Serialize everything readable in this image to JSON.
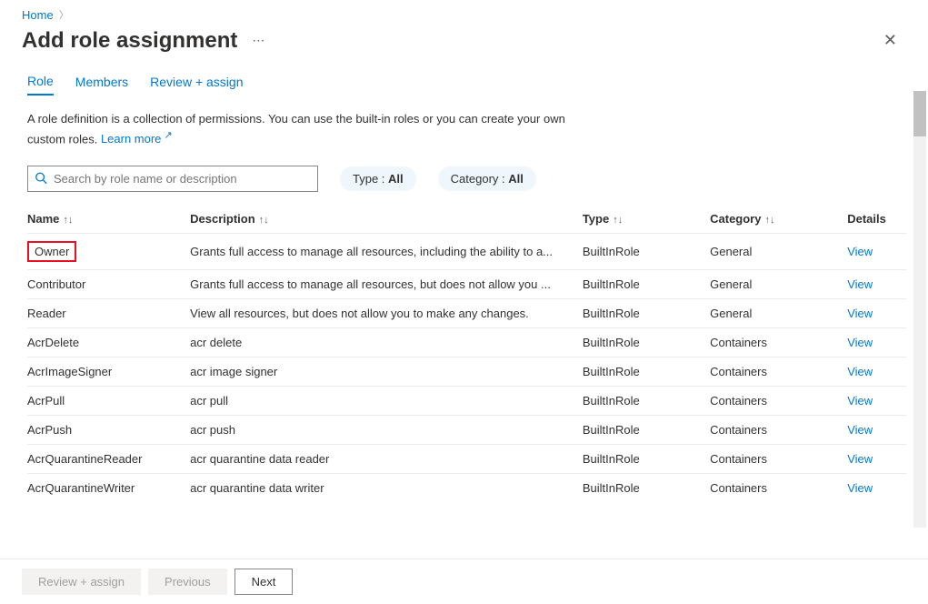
{
  "breadcrumb": {
    "home": "Home"
  },
  "page": {
    "title": "Add role assignment"
  },
  "tabs": {
    "role": "Role",
    "members": "Members",
    "review": "Review + assign"
  },
  "description": {
    "text": "A role definition is a collection of permissions. You can use the built-in roles or you can create your own custom roles.",
    "learn_more": "Learn more"
  },
  "search": {
    "placeholder": "Search by role name or description"
  },
  "filters": {
    "type_label": "Type : ",
    "type_value": "All",
    "category_label": "Category : ",
    "category_value": "All"
  },
  "columns": {
    "name": "Name",
    "description": "Description",
    "type": "Type",
    "category": "Category",
    "details": "Details"
  },
  "view_label": "View",
  "roles": [
    {
      "name": "Owner",
      "description": "Grants full access to manage all resources, including the ability to a...",
      "type": "BuiltInRole",
      "category": "General",
      "highlighted": true
    },
    {
      "name": "Contributor",
      "description": "Grants full access to manage all resources, but does not allow you ...",
      "type": "BuiltInRole",
      "category": "General"
    },
    {
      "name": "Reader",
      "description": "View all resources, but does not allow you to make any changes.",
      "type": "BuiltInRole",
      "category": "General"
    },
    {
      "name": "AcrDelete",
      "description": "acr delete",
      "type": "BuiltInRole",
      "category": "Containers"
    },
    {
      "name": "AcrImageSigner",
      "description": "acr image signer",
      "type": "BuiltInRole",
      "category": "Containers"
    },
    {
      "name": "AcrPull",
      "description": "acr pull",
      "type": "BuiltInRole",
      "category": "Containers"
    },
    {
      "name": "AcrPush",
      "description": "acr push",
      "type": "BuiltInRole",
      "category": "Containers"
    },
    {
      "name": "AcrQuarantineReader",
      "description": "acr quarantine data reader",
      "type": "BuiltInRole",
      "category": "Containers"
    },
    {
      "name": "AcrQuarantineWriter",
      "description": "acr quarantine data writer",
      "type": "BuiltInRole",
      "category": "Containers"
    }
  ],
  "footer": {
    "review": "Review + assign",
    "previous": "Previous",
    "next": "Next"
  }
}
